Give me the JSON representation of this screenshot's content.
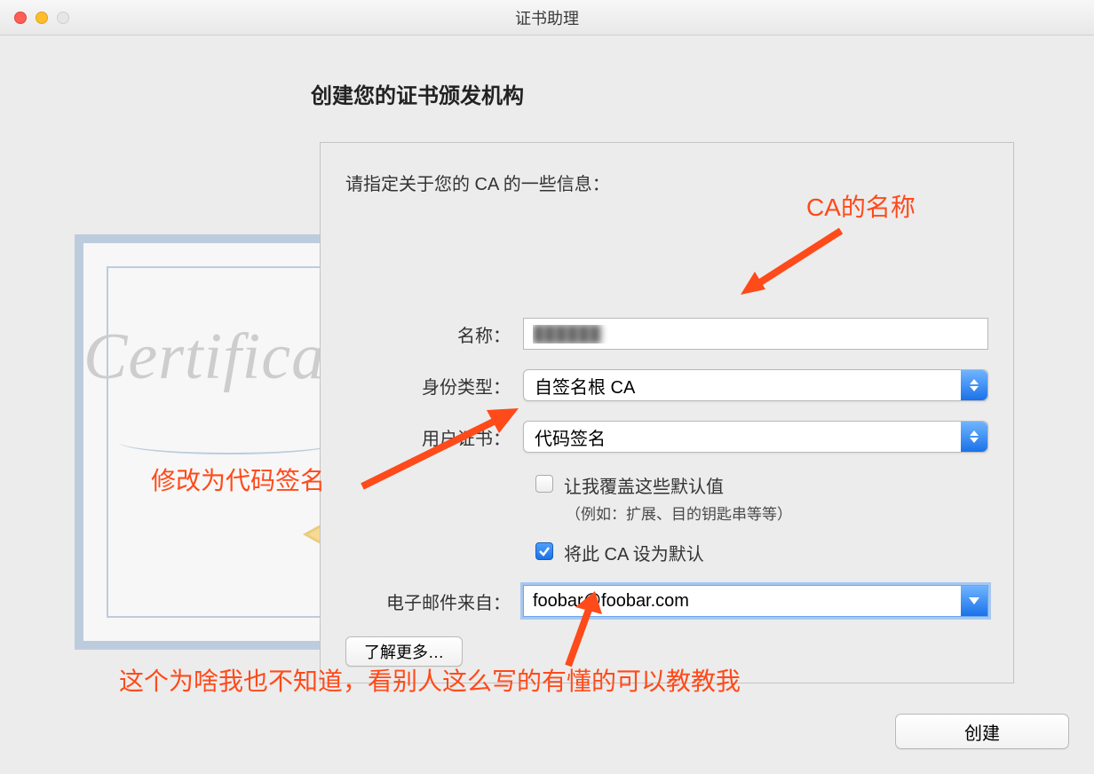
{
  "window": {
    "title": "证书助理"
  },
  "page": {
    "title": "创建您的证书颁发机构"
  },
  "panel": {
    "subtitle": "请指定关于您的 CA 的一些信息：",
    "name_label": "名称：",
    "name_value": "██████",
    "identity_label": "身份类型：",
    "identity_value": "自签名根 CA",
    "usercert_label": "用户证书：",
    "usercert_value": "代码签名",
    "override_checkbox_label": "让我覆盖这些默认值",
    "override_hint": "（例如：扩展、目的钥匙串等等）",
    "override_checked": false,
    "default_ca_label": "将此 CA 设为默认",
    "default_ca_checked": true,
    "email_label": "电子邮件来自：",
    "email_value": "foobar@foobar.com",
    "learn_more_label": "了解更多…"
  },
  "footer": {
    "create_label": "创建"
  },
  "decor": {
    "certificate_word": "Certificate"
  },
  "annotations": {
    "ca_name": "CA的名称",
    "code_sign": "修改为代码签名",
    "email_note": "这个为啥我也不知道，看别人这么写的有懂的可以教教我"
  }
}
